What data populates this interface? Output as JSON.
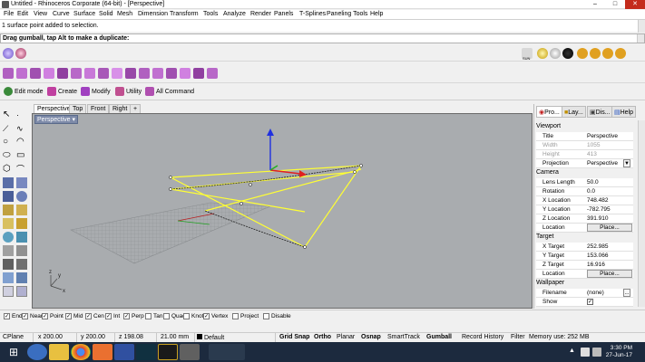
{
  "window": {
    "title": "Untitled - Rhinoceros Corporate (64-bit) - [Perspective]",
    "controls": [
      "minimize-icon",
      "maximize-icon",
      "close-icon"
    ]
  },
  "menu": [
    "File",
    "Edit",
    "View",
    "Curve",
    "Surface",
    "Solid",
    "Mesh",
    "Dimension",
    "Transform",
    "Tools",
    "Analyze",
    "Render",
    "Panels",
    "T-Splines",
    "Paneling Tools",
    "Help"
  ],
  "command": {
    "history": "1 surface point added to selection.",
    "prompt": "Drag gumball, tap Alt to make a duplicate:"
  },
  "toolbar3": {
    "edit_mode": "Edit mode",
    "create": "Create",
    "modify": "Modify",
    "utility": "Utility",
    "all_command": "All Command"
  },
  "toolbar1_right": {
    "sun_label": "SUN"
  },
  "viewport_tabs": [
    "Perspective",
    "Top",
    "Front",
    "Right"
  ],
  "viewport": {
    "label": "Perspective",
    "axis_x": "x",
    "axis_y": "y",
    "axis_z": "z",
    "colors": {
      "background": "#a9acaf",
      "curve": "#ffff33",
      "gumball_x": "#e02020",
      "gumball_y": "#20b020",
      "gumball_z": "#2030e0"
    }
  },
  "right_panel": {
    "tabs": [
      "Pro...",
      "Lay...",
      "Dis...",
      "Help"
    ],
    "viewport_section": "Viewport",
    "viewport_rows": [
      {
        "label": "Title",
        "value": "Perspective"
      },
      {
        "label": "Width",
        "value": "1055"
      },
      {
        "label": "Height",
        "value": "413"
      },
      {
        "label": "Projection",
        "value": "Perspective"
      }
    ],
    "camera_section": "Camera",
    "camera_rows": [
      {
        "label": "Lens Length",
        "value": "50.0"
      },
      {
        "label": "Rotation",
        "value": "0.0"
      },
      {
        "label": "X Location",
        "value": "748.482"
      },
      {
        "label": "Y Location",
        "value": "-782.795"
      },
      {
        "label": "Z Location",
        "value": "391.910"
      },
      {
        "label": "Location",
        "value": "Place..."
      }
    ],
    "target_section": "Target",
    "target_rows": [
      {
        "label": "X Target",
        "value": "252.985"
      },
      {
        "label": "Y Target",
        "value": "153.066"
      },
      {
        "label": "Z Target",
        "value": "16.916"
      },
      {
        "label": "Location",
        "value": "Place..."
      }
    ],
    "wallpaper_section": "Wallpaper",
    "wallpaper_rows": [
      {
        "label": "Filename",
        "value": "(none)"
      },
      {
        "label": "Show",
        "value": "✓"
      }
    ],
    "browse_label": "..."
  },
  "osnaps": [
    {
      "label": "End",
      "checked": true
    },
    {
      "label": "Near",
      "checked": true
    },
    {
      "label": "Point",
      "checked": true
    },
    {
      "label": "Mid",
      "checked": true
    },
    {
      "label": "Cen",
      "checked": true
    },
    {
      "label": "Int",
      "checked": true
    },
    {
      "label": "Perp",
      "checked": true
    },
    {
      "label": "Tan",
      "checked": false
    },
    {
      "label": "Quad",
      "checked": false
    },
    {
      "label": "Knot",
      "checked": false
    },
    {
      "label": "Vertex",
      "checked": true
    },
    {
      "label": "Project",
      "checked": false
    },
    {
      "label": "Disable",
      "checked": false
    }
  ],
  "status": {
    "cplane": "CPlane",
    "x": "x 200.00",
    "y": "y 200.00",
    "z": "z 198.08",
    "units": "21.00 mm",
    "layer": "Default",
    "grid_snap": "Grid Snap",
    "ortho": "Ortho",
    "planar": "Planar",
    "osnap": "Osnap",
    "smarttrack": "SmartTrack",
    "gumball": "Gumball",
    "record_history": "Record History",
    "filter": "Filter",
    "memory": "Memory use: 252 MB"
  },
  "taskbar": {
    "time": "3:30 PM",
    "date": "27-Jun-17"
  }
}
